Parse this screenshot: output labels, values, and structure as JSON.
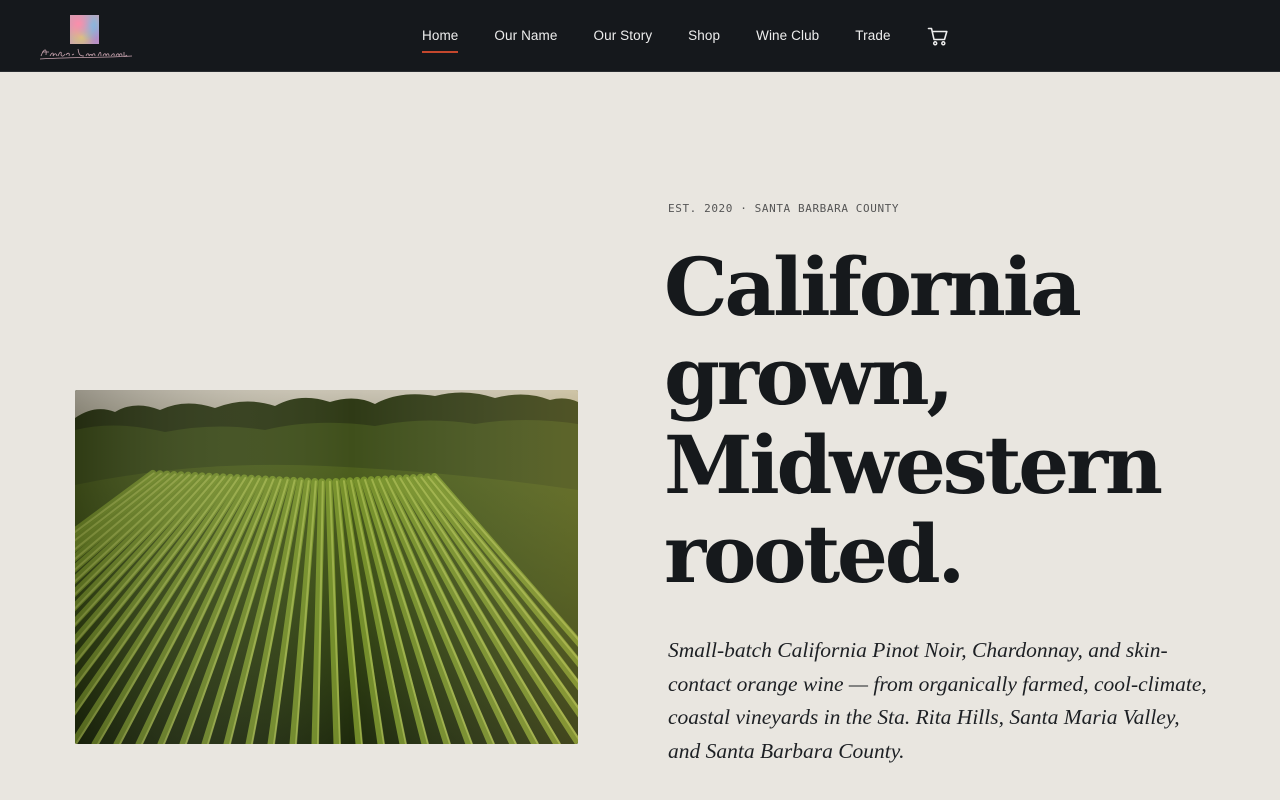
{
  "brand": {
    "logo_alt": "Fates' Lieutenant",
    "logo_script": "Fates' Lieutenant"
  },
  "nav": {
    "items": [
      {
        "label": "Home",
        "active": true
      },
      {
        "label": "Our Name",
        "active": false
      },
      {
        "label": "Our Story",
        "active": false
      },
      {
        "label": "Shop",
        "active": false
      },
      {
        "label": "Wine Club",
        "active": false
      },
      {
        "label": "Trade",
        "active": false
      }
    ],
    "cart_icon": "shopping-cart-icon",
    "active_underline_color": "#c4472d"
  },
  "hero": {
    "eyebrow": "EST. 2020 · SANTA BARBARA COUNTY",
    "headline_lines": [
      "California",
      "grown,",
      "Midwestern",
      "rooted."
    ],
    "intro": "Small-batch California Pinot Noir, Chardonnay, and skin-contact orange wine — from organically farmed, cool-climate, coastal vineyards in the Sta. Rita Hills, Santa Maria Valley, and Santa Barbara County.",
    "image_description": "vineyard rows at sunset"
  },
  "colors": {
    "header_bg": "#15181c",
    "page_bg": "#e9e6e0",
    "text_dark": "#16191c"
  }
}
